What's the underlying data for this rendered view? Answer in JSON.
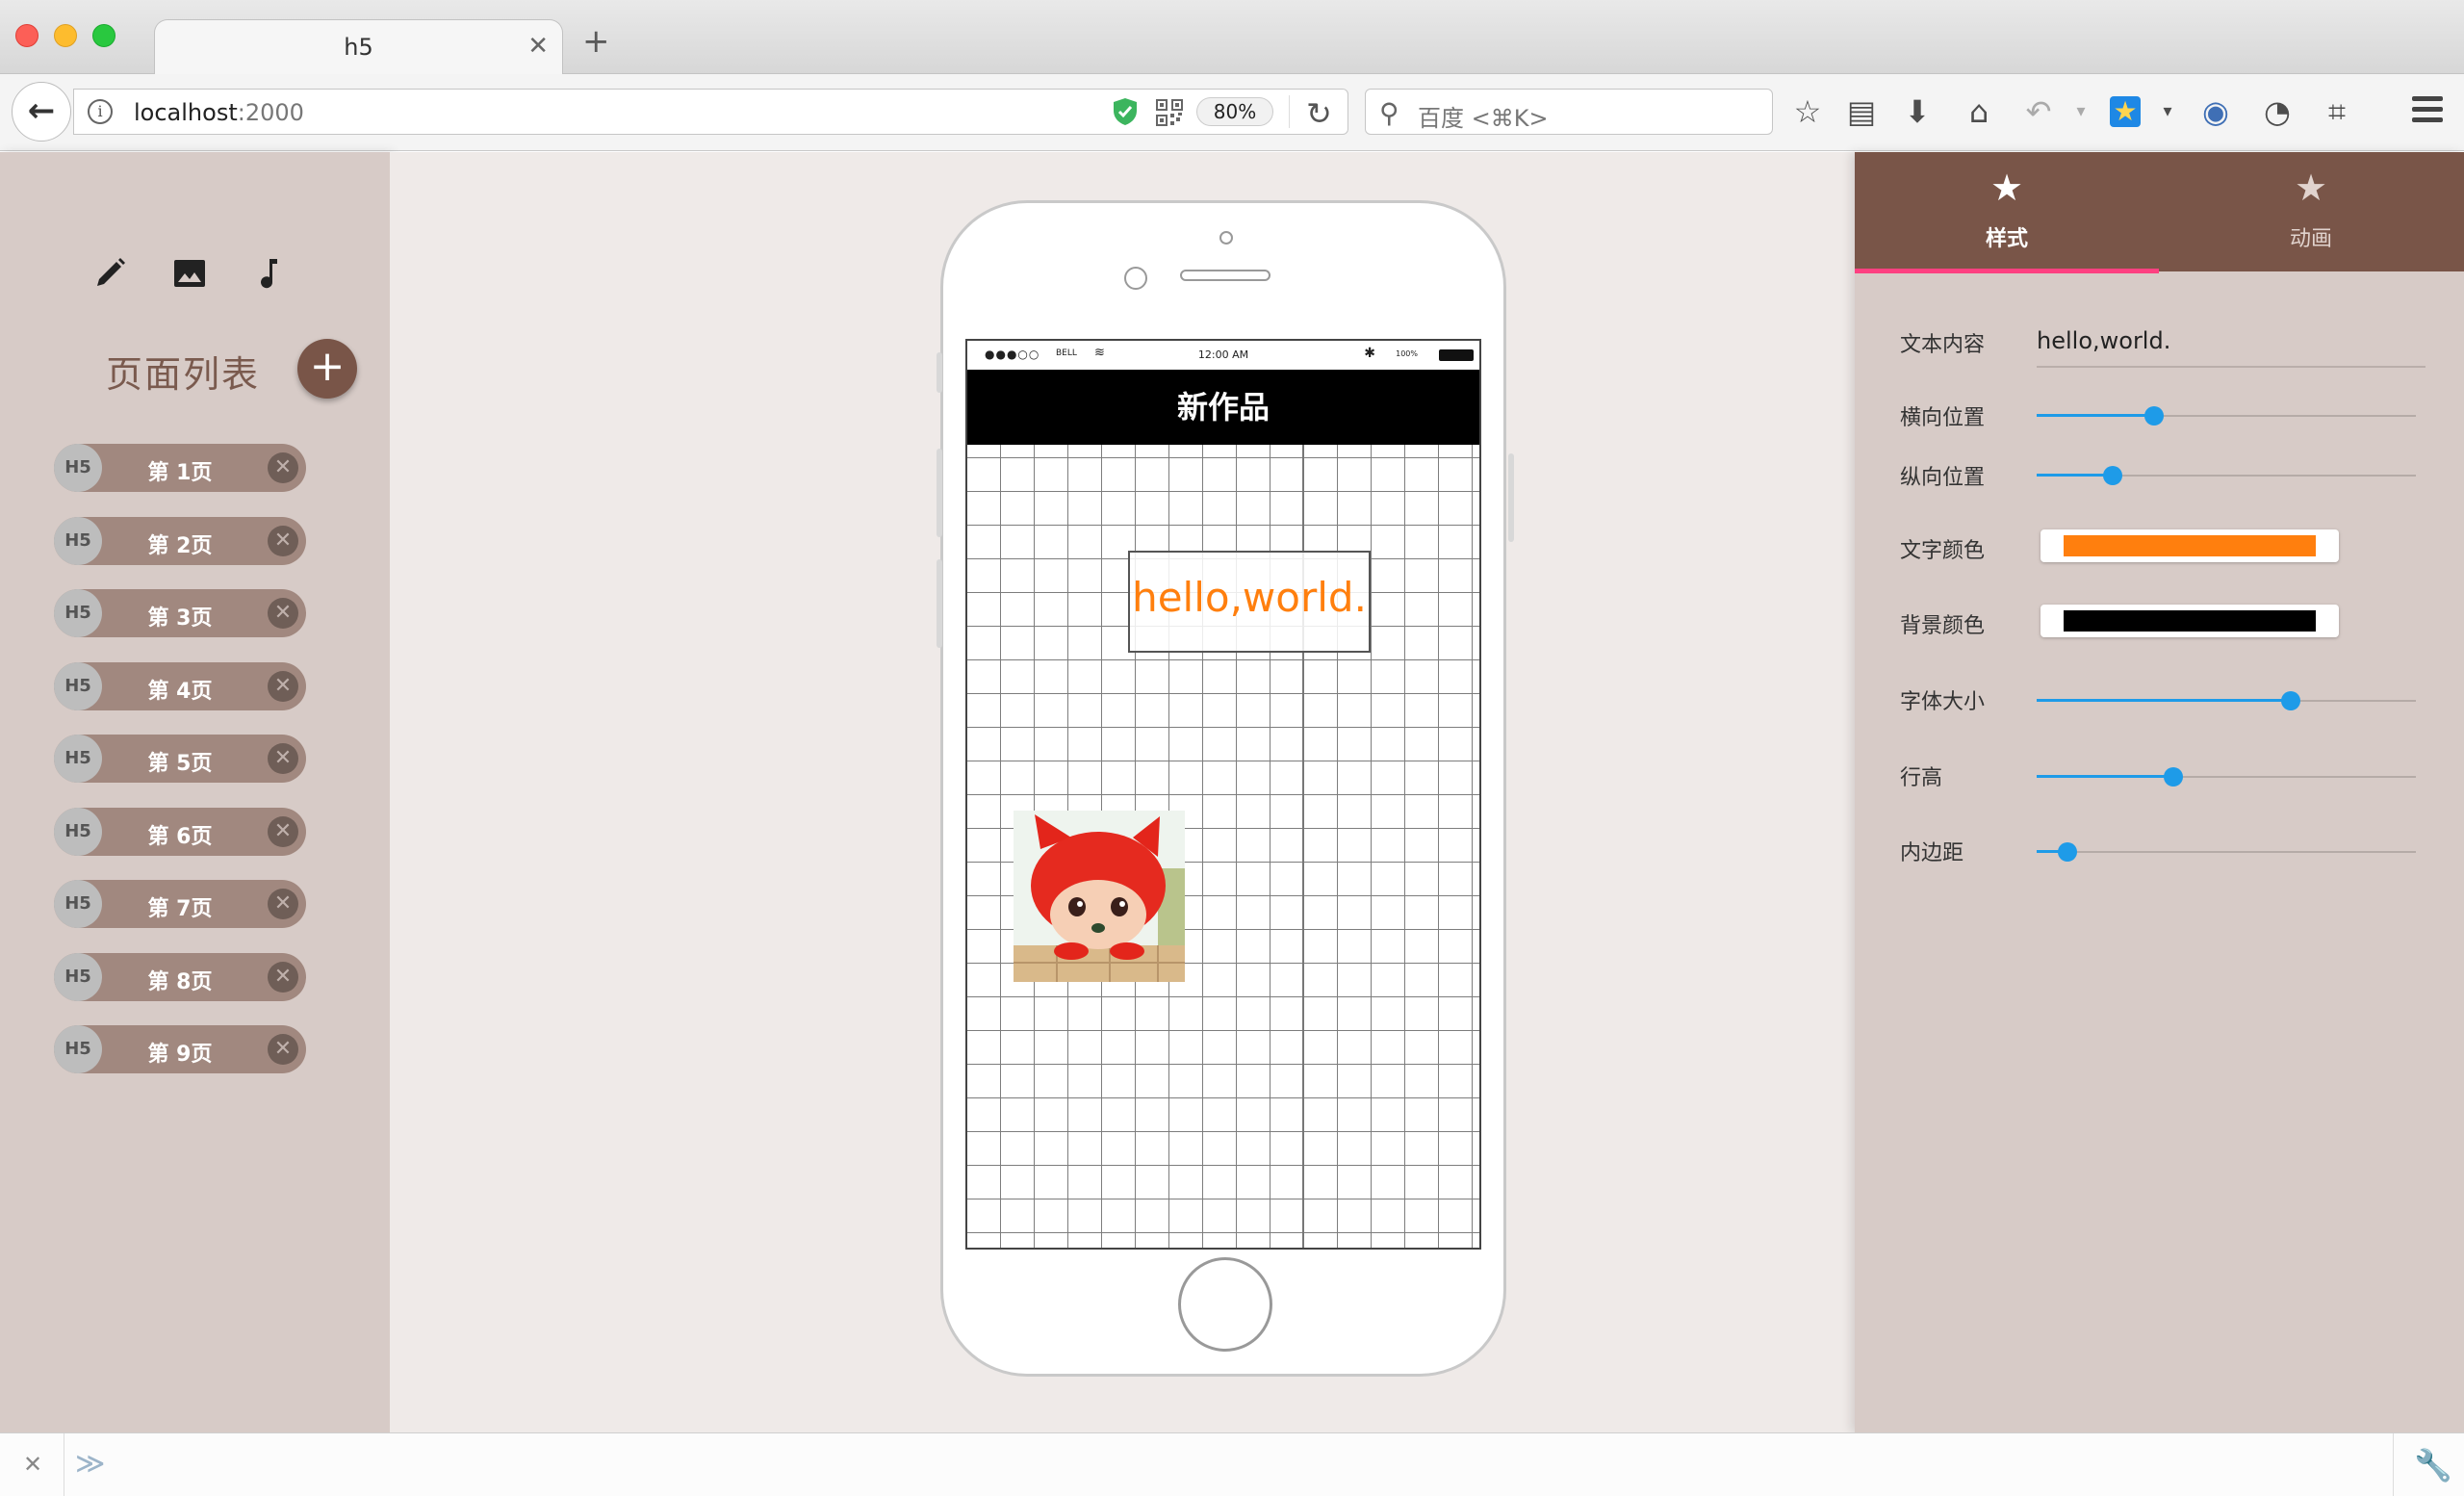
{
  "browser": {
    "tab_title": "h5",
    "tab_close": "✕",
    "new_tab": "+",
    "url_host": "localhost",
    "url_port": ":2000",
    "zoom": "80%",
    "search_placeholder": "百度 <⌘K>",
    "toolbar_icons": [
      "star-icon",
      "reading-list-icon",
      "download-icon",
      "home-icon",
      "undo-icon",
      "extension-star-icon",
      "extension-globe-icon",
      "extension-speedometer-icon",
      "crop-icon",
      "menu-icon"
    ]
  },
  "left_panel": {
    "tools": [
      "pencil-icon",
      "image-icon",
      "music-note-icon"
    ],
    "title": "页面列表",
    "add_label": "+",
    "pages": [
      {
        "avatar": "H5",
        "label": "第 1页"
      },
      {
        "avatar": "H5",
        "label": "第 2页"
      },
      {
        "avatar": "H5",
        "label": "第 3页"
      },
      {
        "avatar": "H5",
        "label": "第 4页"
      },
      {
        "avatar": "H5",
        "label": "第 5页"
      },
      {
        "avatar": "H5",
        "label": "第 6页"
      },
      {
        "avatar": "H5",
        "label": "第 7页"
      },
      {
        "avatar": "H5",
        "label": "第 8页"
      },
      {
        "avatar": "H5",
        "label": "第 9页"
      }
    ],
    "delete_symbol": "✕"
  },
  "phone": {
    "status": {
      "signal": "●●●○○",
      "carrier": "BELL",
      "wifi": "≋",
      "time": "12:00 AM",
      "bluetooth": "✱",
      "battery_pct": "100%"
    },
    "header_title": "新作品",
    "text_element": "hello,world."
  },
  "right_panel": {
    "tabs": [
      {
        "icon": "★",
        "label": "样式",
        "active": true
      },
      {
        "icon": "★",
        "label": "动画",
        "active": false
      }
    ],
    "properties": {
      "text_content_label": "文本内容",
      "text_content_value": "hello,world.",
      "horizontal_label": "横向位置",
      "horizontal_value": 0.31,
      "vertical_label": "纵向位置",
      "vertical_value": 0.2,
      "text_color_label": "文字颜色",
      "text_color": "#ff7f0e",
      "bg_color_label": "背景颜色",
      "bg_color": "#000000",
      "font_size_label": "字体大小",
      "font_size_value": 0.67,
      "line_height_label": "行高",
      "line_height_value": 0.36,
      "padding_label": "内边距",
      "padding_value": 0.08
    }
  },
  "devbar": {
    "close": "✕",
    "prompt": "≫"
  },
  "colors": {
    "accent_brown": "#795548",
    "slider_blue": "#1e9be8",
    "tab_indicator": "#ff4081"
  }
}
